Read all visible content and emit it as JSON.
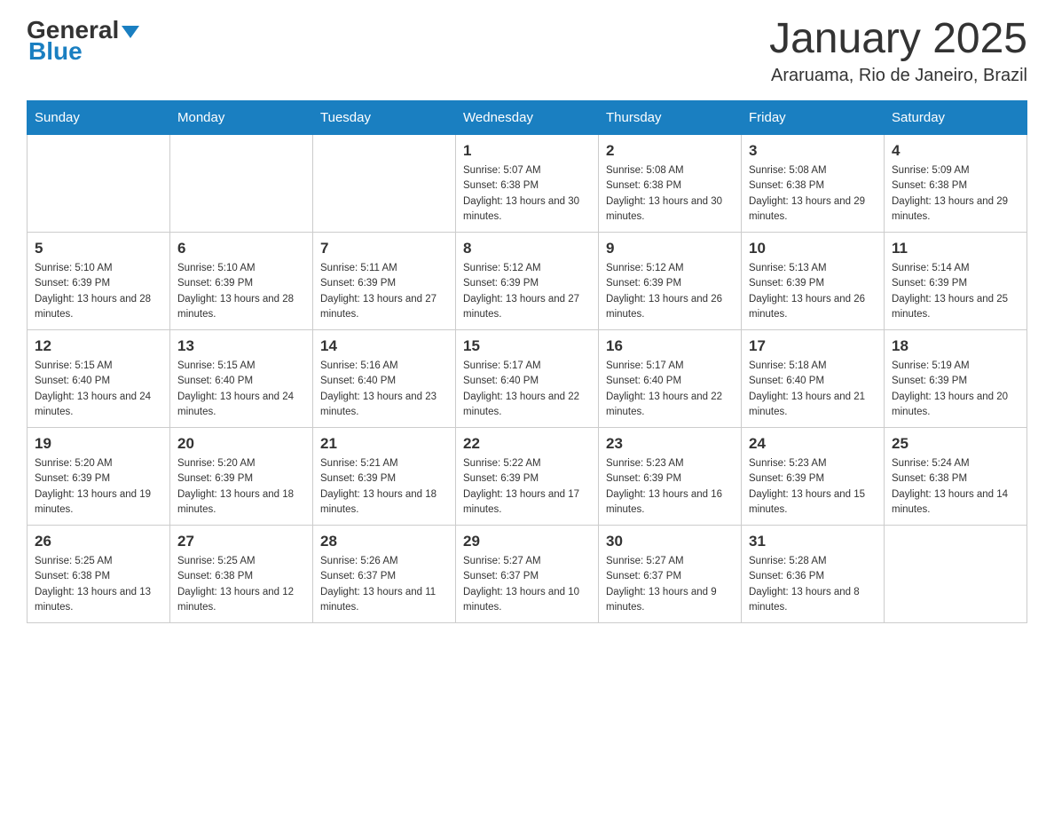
{
  "logo": {
    "general": "General",
    "blue": "Blue"
  },
  "header": {
    "month_year": "January 2025",
    "location": "Araruama, Rio de Janeiro, Brazil"
  },
  "days_of_week": [
    "Sunday",
    "Monday",
    "Tuesday",
    "Wednesday",
    "Thursday",
    "Friday",
    "Saturday"
  ],
  "weeks": [
    [
      {
        "day": "",
        "info": ""
      },
      {
        "day": "",
        "info": ""
      },
      {
        "day": "",
        "info": ""
      },
      {
        "day": "1",
        "info": "Sunrise: 5:07 AM\nSunset: 6:38 PM\nDaylight: 13 hours and 30 minutes."
      },
      {
        "day": "2",
        "info": "Sunrise: 5:08 AM\nSunset: 6:38 PM\nDaylight: 13 hours and 30 minutes."
      },
      {
        "day": "3",
        "info": "Sunrise: 5:08 AM\nSunset: 6:38 PM\nDaylight: 13 hours and 29 minutes."
      },
      {
        "day": "4",
        "info": "Sunrise: 5:09 AM\nSunset: 6:38 PM\nDaylight: 13 hours and 29 minutes."
      }
    ],
    [
      {
        "day": "5",
        "info": "Sunrise: 5:10 AM\nSunset: 6:39 PM\nDaylight: 13 hours and 28 minutes."
      },
      {
        "day": "6",
        "info": "Sunrise: 5:10 AM\nSunset: 6:39 PM\nDaylight: 13 hours and 28 minutes."
      },
      {
        "day": "7",
        "info": "Sunrise: 5:11 AM\nSunset: 6:39 PM\nDaylight: 13 hours and 27 minutes."
      },
      {
        "day": "8",
        "info": "Sunrise: 5:12 AM\nSunset: 6:39 PM\nDaylight: 13 hours and 27 minutes."
      },
      {
        "day": "9",
        "info": "Sunrise: 5:12 AM\nSunset: 6:39 PM\nDaylight: 13 hours and 26 minutes."
      },
      {
        "day": "10",
        "info": "Sunrise: 5:13 AM\nSunset: 6:39 PM\nDaylight: 13 hours and 26 minutes."
      },
      {
        "day": "11",
        "info": "Sunrise: 5:14 AM\nSunset: 6:39 PM\nDaylight: 13 hours and 25 minutes."
      }
    ],
    [
      {
        "day": "12",
        "info": "Sunrise: 5:15 AM\nSunset: 6:40 PM\nDaylight: 13 hours and 24 minutes."
      },
      {
        "day": "13",
        "info": "Sunrise: 5:15 AM\nSunset: 6:40 PM\nDaylight: 13 hours and 24 minutes."
      },
      {
        "day": "14",
        "info": "Sunrise: 5:16 AM\nSunset: 6:40 PM\nDaylight: 13 hours and 23 minutes."
      },
      {
        "day": "15",
        "info": "Sunrise: 5:17 AM\nSunset: 6:40 PM\nDaylight: 13 hours and 22 minutes."
      },
      {
        "day": "16",
        "info": "Sunrise: 5:17 AM\nSunset: 6:40 PM\nDaylight: 13 hours and 22 minutes."
      },
      {
        "day": "17",
        "info": "Sunrise: 5:18 AM\nSunset: 6:40 PM\nDaylight: 13 hours and 21 minutes."
      },
      {
        "day": "18",
        "info": "Sunrise: 5:19 AM\nSunset: 6:39 PM\nDaylight: 13 hours and 20 minutes."
      }
    ],
    [
      {
        "day": "19",
        "info": "Sunrise: 5:20 AM\nSunset: 6:39 PM\nDaylight: 13 hours and 19 minutes."
      },
      {
        "day": "20",
        "info": "Sunrise: 5:20 AM\nSunset: 6:39 PM\nDaylight: 13 hours and 18 minutes."
      },
      {
        "day": "21",
        "info": "Sunrise: 5:21 AM\nSunset: 6:39 PM\nDaylight: 13 hours and 18 minutes."
      },
      {
        "day": "22",
        "info": "Sunrise: 5:22 AM\nSunset: 6:39 PM\nDaylight: 13 hours and 17 minutes."
      },
      {
        "day": "23",
        "info": "Sunrise: 5:23 AM\nSunset: 6:39 PM\nDaylight: 13 hours and 16 minutes."
      },
      {
        "day": "24",
        "info": "Sunrise: 5:23 AM\nSunset: 6:39 PM\nDaylight: 13 hours and 15 minutes."
      },
      {
        "day": "25",
        "info": "Sunrise: 5:24 AM\nSunset: 6:38 PM\nDaylight: 13 hours and 14 minutes."
      }
    ],
    [
      {
        "day": "26",
        "info": "Sunrise: 5:25 AM\nSunset: 6:38 PM\nDaylight: 13 hours and 13 minutes."
      },
      {
        "day": "27",
        "info": "Sunrise: 5:25 AM\nSunset: 6:38 PM\nDaylight: 13 hours and 12 minutes."
      },
      {
        "day": "28",
        "info": "Sunrise: 5:26 AM\nSunset: 6:37 PM\nDaylight: 13 hours and 11 minutes."
      },
      {
        "day": "29",
        "info": "Sunrise: 5:27 AM\nSunset: 6:37 PM\nDaylight: 13 hours and 10 minutes."
      },
      {
        "day": "30",
        "info": "Sunrise: 5:27 AM\nSunset: 6:37 PM\nDaylight: 13 hours and 9 minutes."
      },
      {
        "day": "31",
        "info": "Sunrise: 5:28 AM\nSunset: 6:36 PM\nDaylight: 13 hours and 8 minutes."
      },
      {
        "day": "",
        "info": ""
      }
    ]
  ]
}
